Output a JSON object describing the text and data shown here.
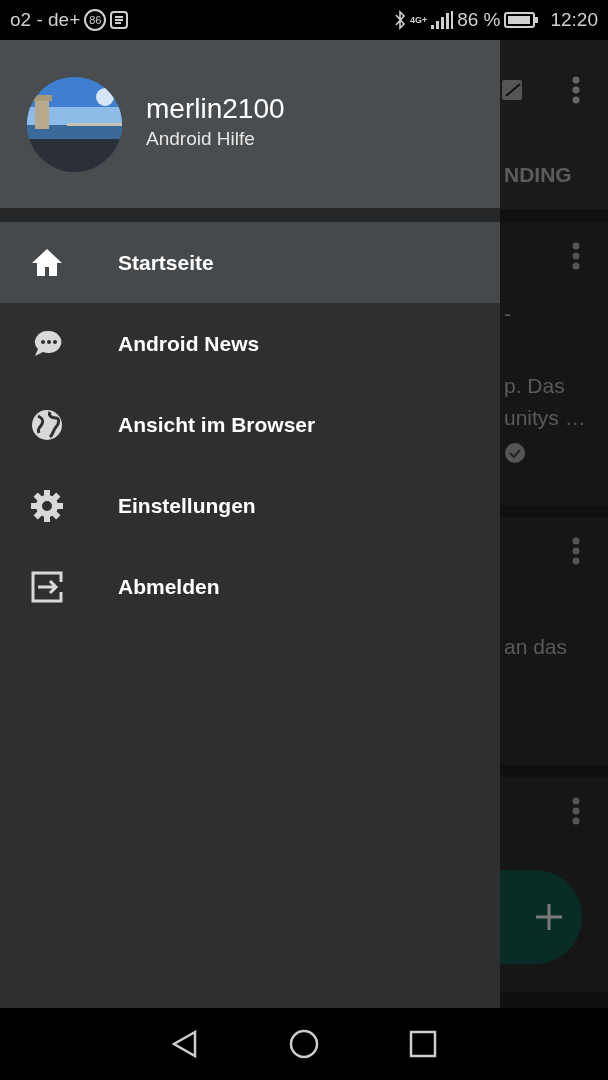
{
  "status_bar": {
    "carrier": "o2 - de+",
    "data_usage_badge": "86",
    "network_type": "4G+",
    "battery_percent": "86 %",
    "time": "12:20"
  },
  "drawer": {
    "account": {
      "username": "merlin2100",
      "subtitle": "Android Hilfe"
    },
    "items": [
      {
        "kind": "home",
        "label": "Startseite",
        "selected": true
      },
      {
        "kind": "chat",
        "label": "Android News",
        "selected": false
      },
      {
        "kind": "globe",
        "label": "Ansicht im Browser",
        "selected": false
      },
      {
        "kind": "gear",
        "label": "Einstellungen",
        "selected": false
      },
      {
        "kind": "logout",
        "label": "Abmelden",
        "selected": false
      }
    ]
  },
  "background": {
    "tab_label": "NDING",
    "cards": [
      {
        "texts": [
          "-",
          "p. Das",
          "unitys …"
        ],
        "verified": true
      },
      {
        "texts": [
          "an das"
        ],
        "verified": false
      },
      {
        "verified": false
      }
    ]
  }
}
